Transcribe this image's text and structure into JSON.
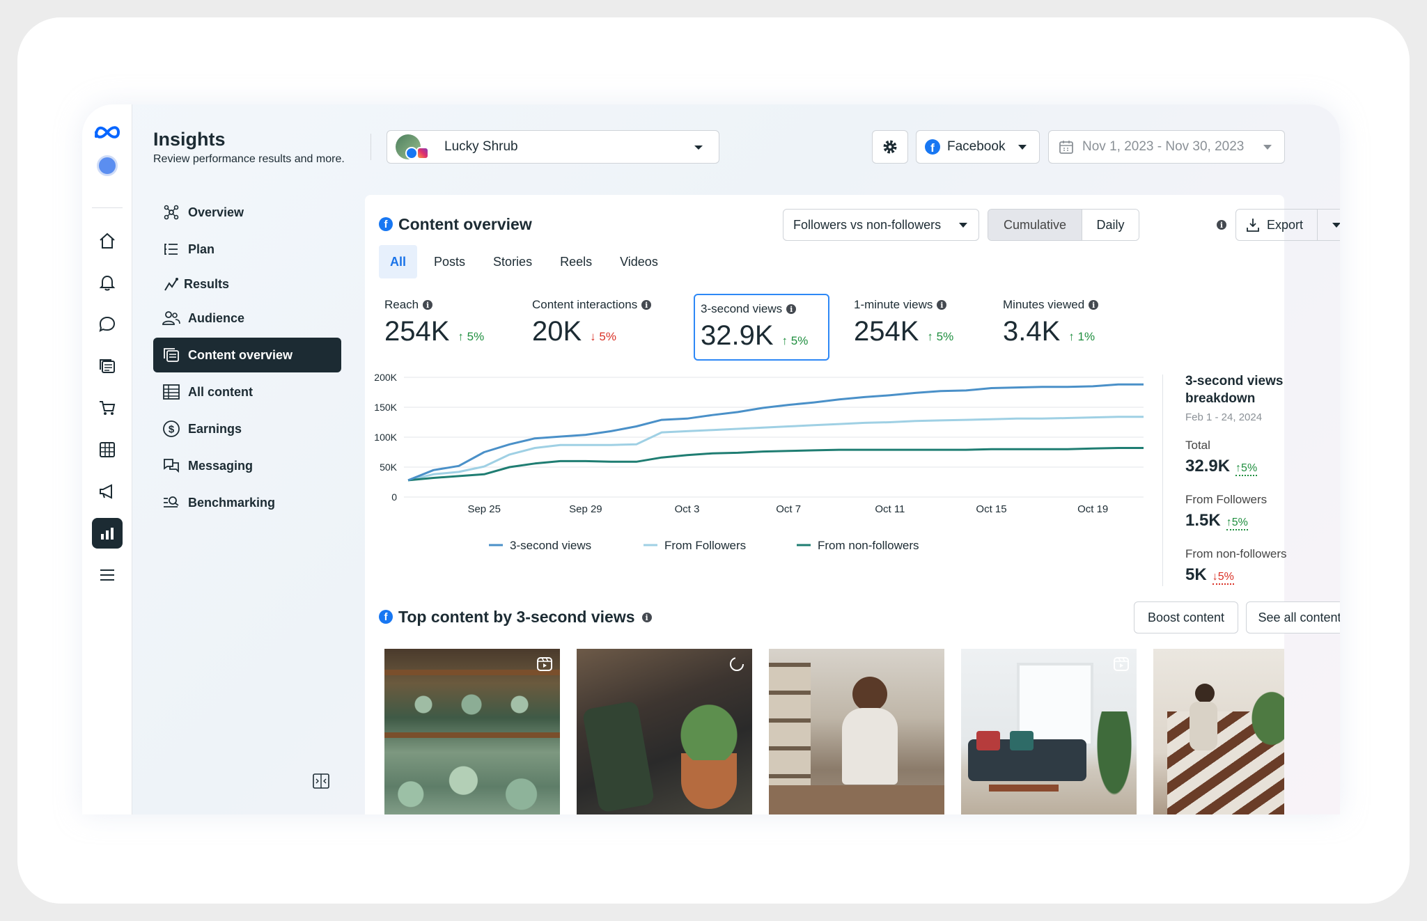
{
  "header": {
    "title": "Insights",
    "subtitle": "Review performance results and more.",
    "page_name": "Lucky Shrub",
    "platform": "Facebook",
    "date_range": "Nov 1, 2023 - Nov 30, 2023"
  },
  "nav": {
    "items": [
      {
        "label": "Overview",
        "icon": "overview-icon"
      },
      {
        "label": "Plan",
        "icon": "plan-icon"
      },
      {
        "label": "Results",
        "icon": "results-icon"
      },
      {
        "label": "Audience",
        "icon": "audience-icon"
      },
      {
        "label": "Content overview",
        "icon": "content-overview-icon",
        "active": true
      },
      {
        "label": "All content",
        "icon": "table-icon"
      },
      {
        "label": "Earnings",
        "icon": "dollar-icon"
      },
      {
        "label": "Messaging",
        "icon": "messaging-icon"
      },
      {
        "label": "Benchmarking",
        "icon": "benchmark-icon"
      }
    ]
  },
  "rail_icons": [
    "meta-logo",
    "profile-avatar",
    "home-icon",
    "bell-icon",
    "chat-icon",
    "pages-icon",
    "cart-icon",
    "grid-icon",
    "megaphone-icon",
    "insights-icon",
    "menu-icon"
  ],
  "content_overview": {
    "title": "Content overview",
    "comparison": "Followers vs non-followers",
    "mode_cumulative": "Cumulative",
    "mode_daily": "Daily",
    "export": "Export",
    "tabs": [
      "All",
      "Posts",
      "Stories",
      "Reels",
      "Videos"
    ],
    "active_tab": "All",
    "metrics": [
      {
        "label": "Reach",
        "value": "254K",
        "change": "5%",
        "dir": "up"
      },
      {
        "label": "Content interactions",
        "value": "20K",
        "change": "5%",
        "dir": "down"
      },
      {
        "label": "3-second views",
        "value": "32.9K",
        "change": "5%",
        "dir": "up",
        "selected": true
      },
      {
        "label": "1-minute views",
        "value": "254K",
        "change": "5%",
        "dir": "up"
      },
      {
        "label": "Minutes viewed",
        "value": "3.4K",
        "change": "1%",
        "dir": "up"
      }
    ]
  },
  "chart_data": {
    "type": "line",
    "x": [
      "Sep 25",
      "Sep 29",
      "Oct 3",
      "Oct 7",
      "Oct 11",
      "Oct 15",
      "Oct 19"
    ],
    "ylim": [
      0,
      200000
    ],
    "y_ticks": [
      "0",
      "50K",
      "100K",
      "150K",
      "200K"
    ],
    "grid": true,
    "legend": "bottom",
    "series": [
      {
        "name": "3-second views",
        "color": "#4a90c8",
        "points": [
          [
            0,
            28000
          ],
          [
            2,
            45000
          ],
          [
            4,
            52000
          ],
          [
            6,
            75000
          ],
          [
            8,
            88000
          ],
          [
            10,
            98000
          ],
          [
            12,
            101000
          ],
          [
            14,
            104000
          ],
          [
            16,
            110000
          ],
          [
            18,
            118000
          ],
          [
            20,
            129000
          ],
          [
            22,
            131000
          ],
          [
            24,
            137000
          ],
          [
            26,
            142000
          ],
          [
            28,
            149000
          ],
          [
            30,
            154000
          ],
          [
            32,
            158000
          ],
          [
            34,
            163000
          ],
          [
            36,
            167000
          ],
          [
            38,
            170000
          ],
          [
            40,
            174000
          ],
          [
            42,
            177000
          ],
          [
            44,
            178000
          ],
          [
            46,
            182000
          ],
          [
            48,
            183000
          ],
          [
            50,
            184000
          ],
          [
            52,
            184000
          ],
          [
            54,
            185000
          ],
          [
            56,
            188000
          ],
          [
            58,
            188000
          ]
        ]
      },
      {
        "name": "From Followers",
        "color": "#9fd0e4",
        "points": [
          [
            0,
            28000
          ],
          [
            2,
            38000
          ],
          [
            4,
            42000
          ],
          [
            6,
            51000
          ],
          [
            8,
            71000
          ],
          [
            10,
            82000
          ],
          [
            12,
            87000
          ],
          [
            14,
            87000
          ],
          [
            16,
            87000
          ],
          [
            18,
            88000
          ],
          [
            20,
            108000
          ],
          [
            22,
            110000
          ],
          [
            24,
            112000
          ],
          [
            26,
            114000
          ],
          [
            28,
            116000
          ],
          [
            30,
            118000
          ],
          [
            32,
            120000
          ],
          [
            34,
            122000
          ],
          [
            36,
            124000
          ],
          [
            38,
            125000
          ],
          [
            40,
            127000
          ],
          [
            42,
            128000
          ],
          [
            44,
            129000
          ],
          [
            46,
            130000
          ],
          [
            48,
            131000
          ],
          [
            50,
            131000
          ],
          [
            52,
            132000
          ],
          [
            54,
            133000
          ],
          [
            56,
            134000
          ],
          [
            58,
            134000
          ]
        ]
      },
      {
        "name": "From non-followers",
        "color": "#1f7d72",
        "points": [
          [
            0,
            28000
          ],
          [
            2,
            32000
          ],
          [
            4,
            35000
          ],
          [
            6,
            38000
          ],
          [
            8,
            50000
          ],
          [
            10,
            56000
          ],
          [
            12,
            60000
          ],
          [
            14,
            60000
          ],
          [
            16,
            59000
          ],
          [
            18,
            59000
          ],
          [
            20,
            66000
          ],
          [
            22,
            70000
          ],
          [
            24,
            73000
          ],
          [
            26,
            74000
          ],
          [
            28,
            76000
          ],
          [
            30,
            77000
          ],
          [
            32,
            78000
          ],
          [
            34,
            79000
          ],
          [
            36,
            79000
          ],
          [
            38,
            79000
          ],
          [
            40,
            79000
          ],
          [
            42,
            79000
          ],
          [
            44,
            79000
          ],
          [
            46,
            80000
          ],
          [
            48,
            80000
          ],
          [
            50,
            80000
          ],
          [
            52,
            80000
          ],
          [
            54,
            81000
          ],
          [
            56,
            82000
          ],
          [
            58,
            82000
          ]
        ]
      }
    ]
  },
  "breakdown": {
    "title": "3-second views breakdown",
    "date": "Feb 1 - 24, 2024",
    "rows": [
      {
        "label": "Total",
        "value": "32.9K",
        "change": "5%",
        "dir": "up"
      },
      {
        "label": "From Followers",
        "value": "1.5K",
        "change": "5%",
        "dir": "up"
      },
      {
        "label": "From non-followers",
        "value": "5K",
        "change": "5%",
        "dir": "down"
      }
    ]
  },
  "top_content": {
    "title": "Top content by 3-second views",
    "boost": "Boost content",
    "see_all": "See all content",
    "thumbnails": [
      {
        "desc": "greenhouse-succulents",
        "badge": "reel-icon"
      },
      {
        "desc": "watering-plant",
        "badge": "loading-icon"
      },
      {
        "desc": "person-on-phone",
        "badge": ""
      },
      {
        "desc": "living-room",
        "badge": "reel-icon"
      },
      {
        "desc": "staircase-plants",
        "badge": ""
      }
    ]
  }
}
